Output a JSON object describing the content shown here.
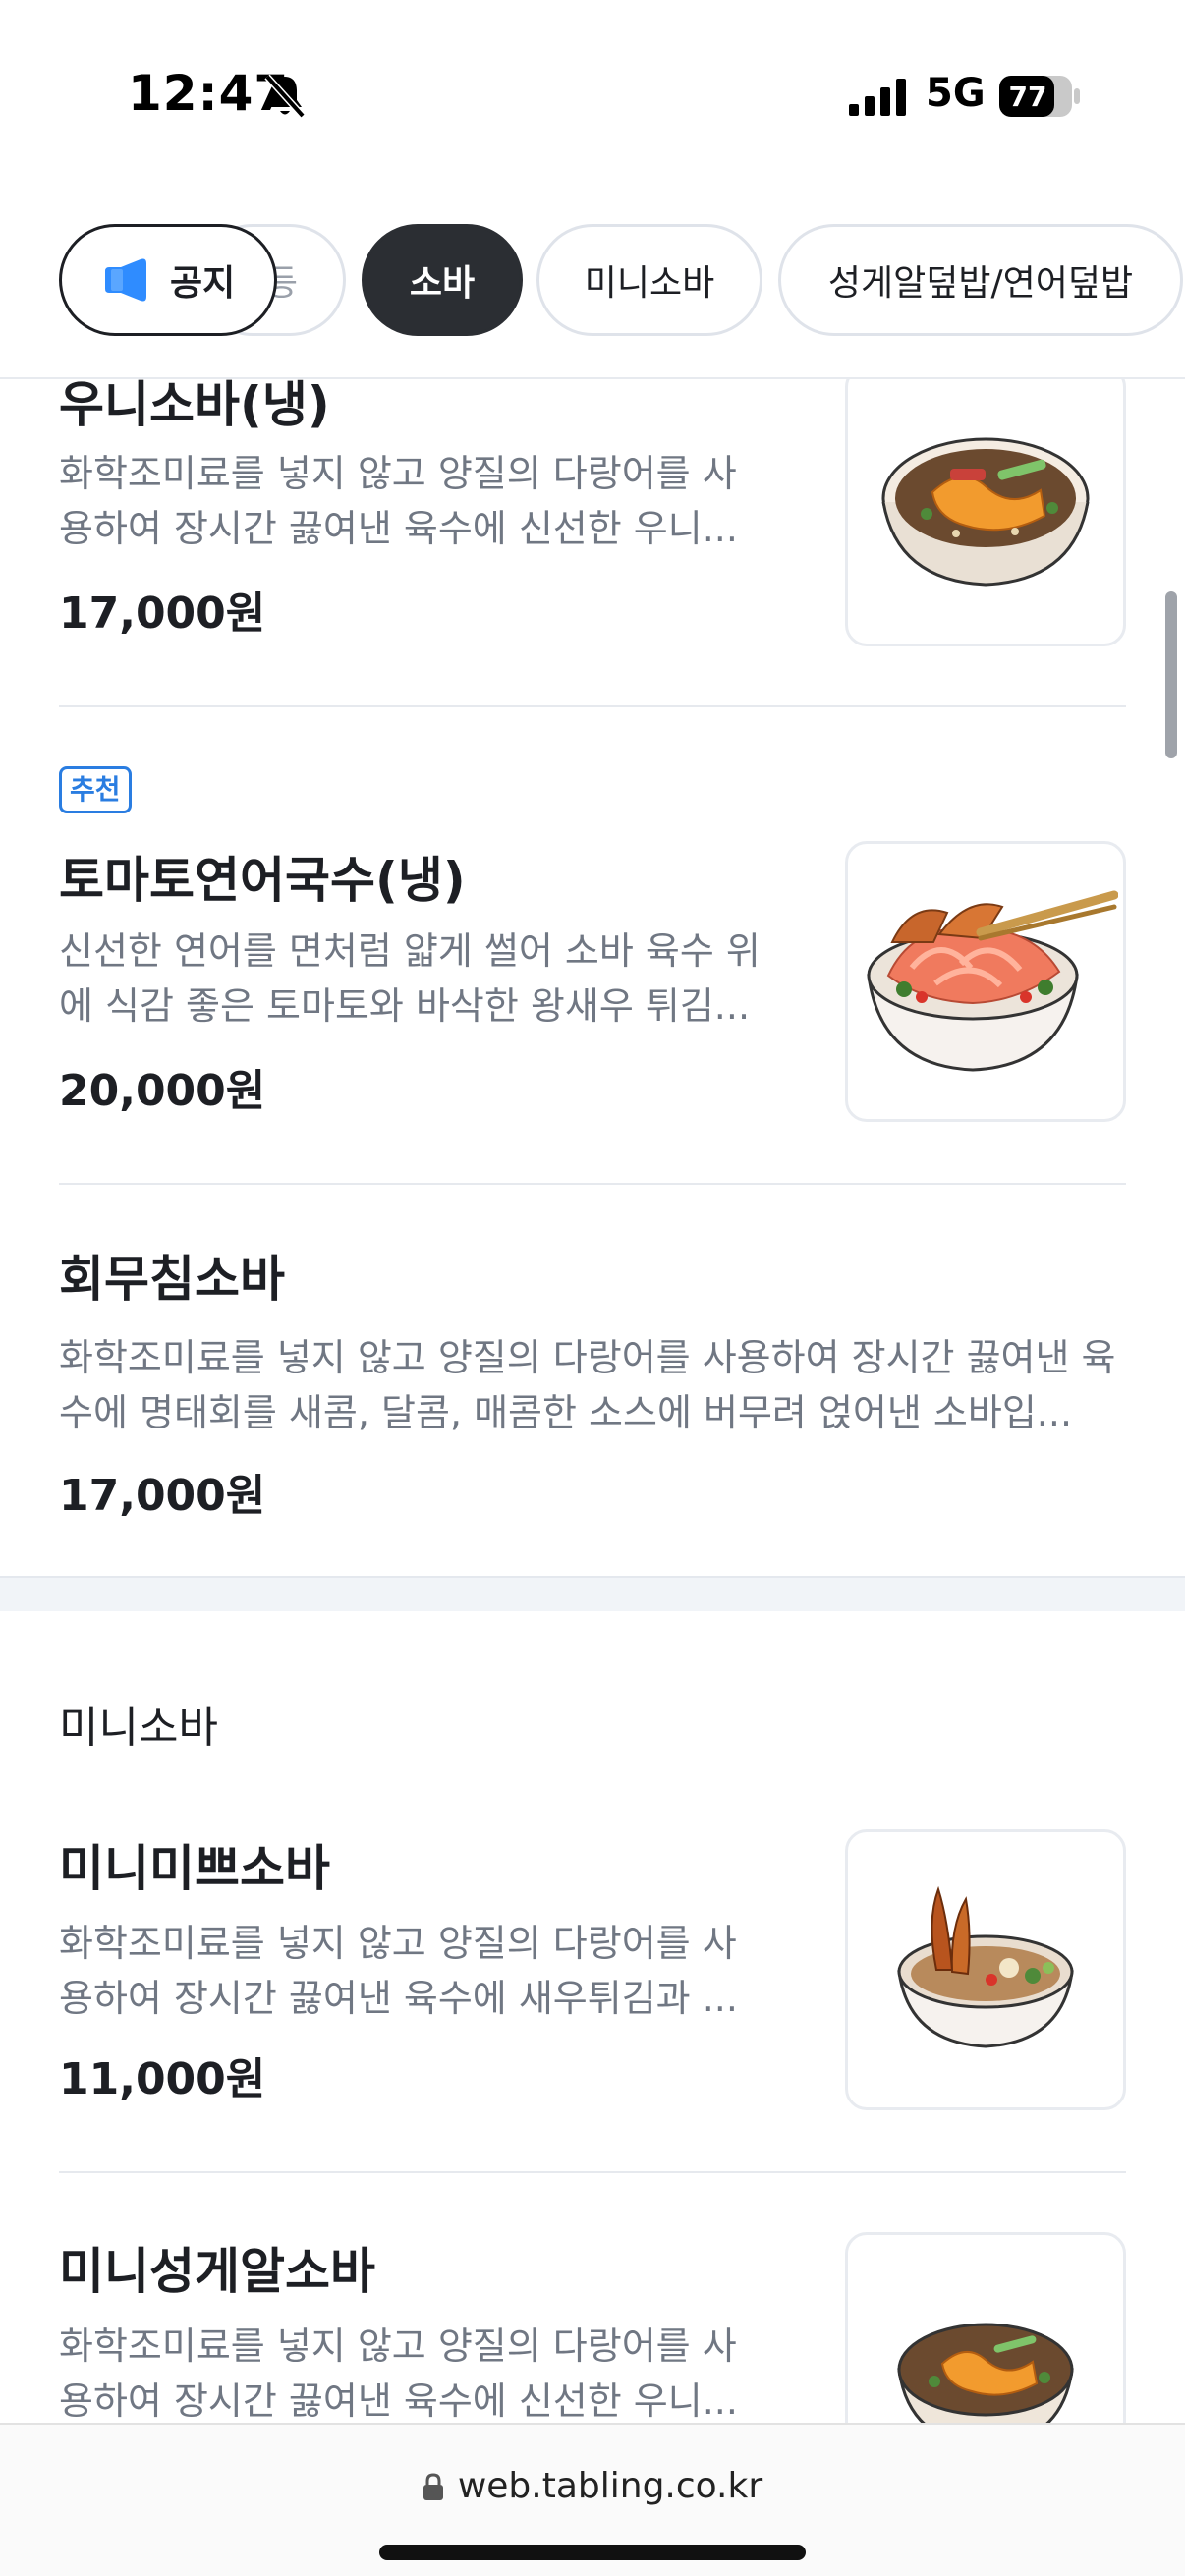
{
  "status_bar": {
    "time": "12:47",
    "network": "5G",
    "battery": "77"
  },
  "tabs": {
    "notice_label": "공지",
    "partial_label": "등",
    "items": [
      {
        "label": "소바",
        "active": true
      },
      {
        "label": "미니소바",
        "active": false
      },
      {
        "label": "성게알덮밥/연어덮밥",
        "active": false
      }
    ]
  },
  "menu": [
    {
      "name": "우니소바(냉)",
      "description": "화학조미료를 넣지 않고 양질의 다랑어를 사용하여 장시간 끓여낸 육수에 신선한 우니...",
      "price": "17,000원",
      "image": "soba-bowl-image"
    },
    {
      "badge": "추천",
      "name": "토마토연어국수(냉)",
      "description": "신선한 연어를 면처럼 얇게 썰어 소바 육수 위에 식감 좋은 토마토와 바삭한 왕새우 튀김...",
      "price": "20,000원",
      "image": "salmon-noodle-image"
    },
    {
      "name": "회무침소바",
      "description": "화학조미료를 넣지 않고 양질의 다랑어를 사용하여 장시간 끓여낸 육수에 명태회를 새콤, 달콤, 매콤한 소스에 버무려 얹어낸 소바입...",
      "price": "17,000원"
    }
  ],
  "mini_section": {
    "title": "미니소바",
    "items": [
      {
        "name": "미니미쁘소바",
        "description": "화학조미료를 넣지 않고 양질의 다랑어를 사용하여 장시간 끓여낸 육수에 새우튀김과 ...",
        "price": "11,000원",
        "image": "shrimp-soba-image"
      },
      {
        "name": "미니성게알소바",
        "description": "화학조미료를 넣지 않고 양질의 다랑어를 사용하여 장시간 끓여낸 육수에 신선한 우니...",
        "image": "urchin-soba-image"
      }
    ]
  },
  "browser": {
    "url": "web.tabling.co.kr"
  },
  "colors": {
    "accent_blue": "#2a7de1",
    "active_chip": "#2b2e33",
    "desc_gray": "#707783"
  }
}
